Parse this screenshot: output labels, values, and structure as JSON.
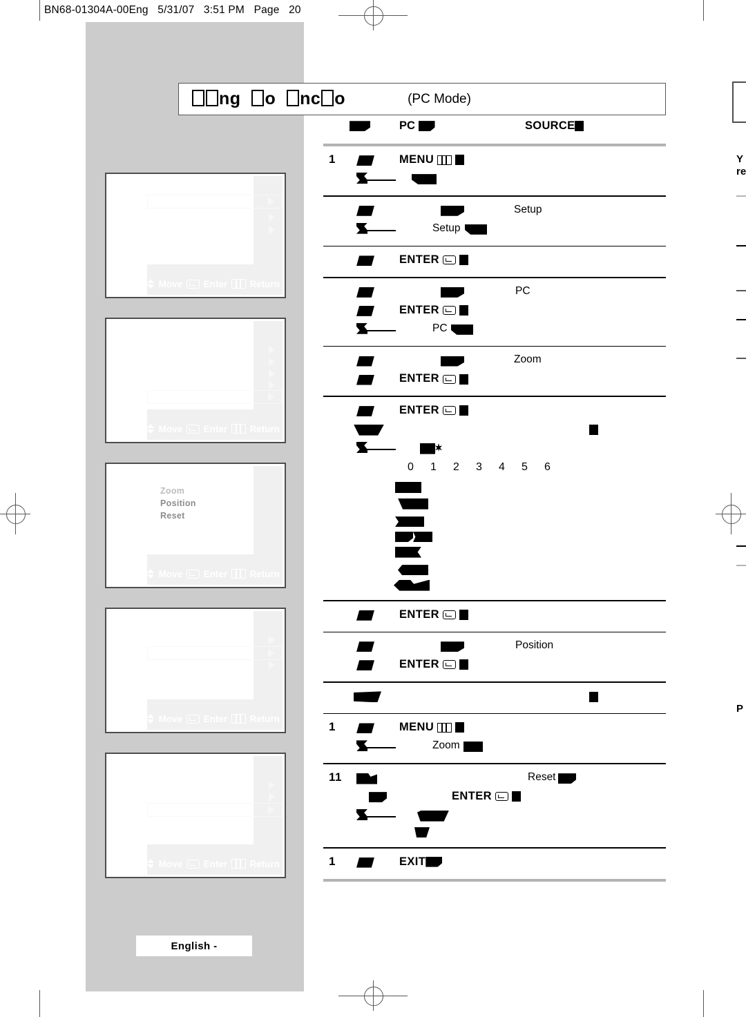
{
  "page": {
    "slug_parts": [
      "BN68-01304A-00Eng",
      "5/31/07",
      "3:51 PM",
      "Page",
      "20"
    ],
    "language_footer": "English -"
  },
  "title_bar": {
    "heading_corrupt": "□□ng □o □nc□o",
    "mode": "(PC Mode)"
  },
  "intro_line": {
    "keyword_pc": "PC",
    "keyword_source": "SOURCE"
  },
  "osd_screens": [
    {
      "name": "osd-screen-1",
      "rows": 3,
      "selected_row": 1,
      "labels": [],
      "footer": {
        "move": "Move",
        "enter": "Enter",
        "return": "Return"
      }
    },
    {
      "name": "osd-screen-2",
      "rows": 5,
      "selected_row": 5,
      "labels": [],
      "footer": {
        "move": "Move",
        "enter": "Enter",
        "return": "Return"
      }
    },
    {
      "name": "osd-screen-3",
      "rows": 0,
      "selected_row": 0,
      "labels": [
        "Zoom",
        "Position",
        "Reset"
      ],
      "footer": {
        "move": "Move",
        "enter": "Enter",
        "return": "Return"
      }
    },
    {
      "name": "osd-screen-4",
      "rows": 3,
      "selected_row": 2,
      "labels": [],
      "footer": {
        "move": "Move",
        "enter": "Enter",
        "return": "Return"
      }
    },
    {
      "name": "osd-screen-5",
      "rows": 3,
      "selected_row": 3,
      "labels": [],
      "footer": {
        "move": "Move",
        "enter": "Enter",
        "return": "Return"
      }
    }
  ],
  "steps": [
    {
      "number": "1",
      "keyword": "MENU",
      "glyph": "menu"
    },
    {
      "number": "",
      "keyword": "Setup",
      "glyph": ""
    },
    {
      "number": "",
      "keyword": "ENTER",
      "glyph": "enter"
    },
    {
      "number": "",
      "keyword": "PC",
      "glyph": "enter"
    },
    {
      "number": "",
      "keyword": "Zoom",
      "glyph": "enter"
    },
    {
      "number": "",
      "keyword": "ENTER",
      "glyph": "enter"
    },
    {
      "number": "",
      "keyword": "ENTER",
      "glyph": "enter"
    },
    {
      "number": "",
      "keyword": "Position",
      "glyph": "enter"
    },
    {
      "number": "1",
      "keyword": "MENU",
      "glyph": "menu"
    },
    {
      "number": "11",
      "keyword": "Reset",
      "glyph": "enter"
    },
    {
      "number": "1",
      "keyword": "EXIT",
      "glyph": ""
    }
  ],
  "labels": {
    "menu": "MENU",
    "enter": "ENTER",
    "exit": "EXIT",
    "setup": "Setup",
    "pc": "PC",
    "zoom": "Zoom",
    "position": "Position",
    "reset": "Reset"
  },
  "zoom_scale": {
    "digits": [
      "0",
      "1",
      "2",
      "3",
      "4",
      "5",
      "6"
    ]
  },
  "right_edge": {
    "frag_1": "Y",
    "frag_2": "re",
    "frag_3": "P"
  },
  "colors": {
    "page_grey": "#cccccc",
    "rule_grey": "#b3b3b3",
    "osd_panel": "#f0f0f0",
    "osd_border": "#4d4d4d",
    "text": "#000000"
  }
}
